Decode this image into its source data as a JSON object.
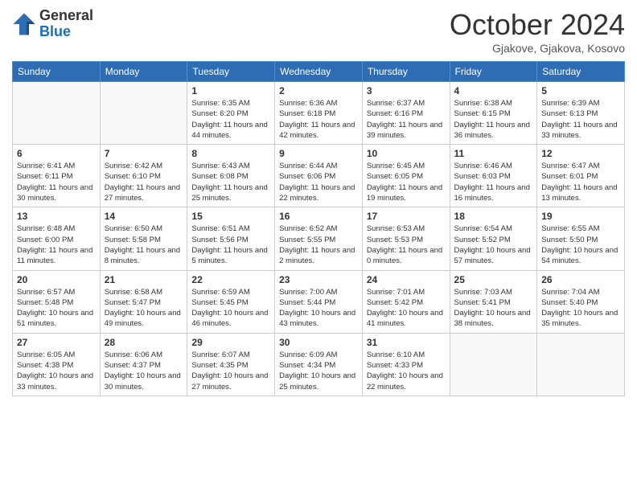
{
  "header": {
    "logo_line1": "General",
    "logo_line2": "Blue",
    "month_title": "October 2024",
    "location": "Gjakove, Gjakova, Kosovo"
  },
  "days_of_week": [
    "Sunday",
    "Monday",
    "Tuesday",
    "Wednesday",
    "Thursday",
    "Friday",
    "Saturday"
  ],
  "weeks": [
    [
      {
        "day": "",
        "info": ""
      },
      {
        "day": "",
        "info": ""
      },
      {
        "day": "1",
        "info": "Sunrise: 6:35 AM\nSunset: 6:20 PM\nDaylight: 11 hours and 44 minutes."
      },
      {
        "day": "2",
        "info": "Sunrise: 6:36 AM\nSunset: 6:18 PM\nDaylight: 11 hours and 42 minutes."
      },
      {
        "day": "3",
        "info": "Sunrise: 6:37 AM\nSunset: 6:16 PM\nDaylight: 11 hours and 39 minutes."
      },
      {
        "day": "4",
        "info": "Sunrise: 6:38 AM\nSunset: 6:15 PM\nDaylight: 11 hours and 36 minutes."
      },
      {
        "day": "5",
        "info": "Sunrise: 6:39 AM\nSunset: 6:13 PM\nDaylight: 11 hours and 33 minutes."
      }
    ],
    [
      {
        "day": "6",
        "info": "Sunrise: 6:41 AM\nSunset: 6:11 PM\nDaylight: 11 hours and 30 minutes."
      },
      {
        "day": "7",
        "info": "Sunrise: 6:42 AM\nSunset: 6:10 PM\nDaylight: 11 hours and 27 minutes."
      },
      {
        "day": "8",
        "info": "Sunrise: 6:43 AM\nSunset: 6:08 PM\nDaylight: 11 hours and 25 minutes."
      },
      {
        "day": "9",
        "info": "Sunrise: 6:44 AM\nSunset: 6:06 PM\nDaylight: 11 hours and 22 minutes."
      },
      {
        "day": "10",
        "info": "Sunrise: 6:45 AM\nSunset: 6:05 PM\nDaylight: 11 hours and 19 minutes."
      },
      {
        "day": "11",
        "info": "Sunrise: 6:46 AM\nSunset: 6:03 PM\nDaylight: 11 hours and 16 minutes."
      },
      {
        "day": "12",
        "info": "Sunrise: 6:47 AM\nSunset: 6:01 PM\nDaylight: 11 hours and 13 minutes."
      }
    ],
    [
      {
        "day": "13",
        "info": "Sunrise: 6:48 AM\nSunset: 6:00 PM\nDaylight: 11 hours and 11 minutes."
      },
      {
        "day": "14",
        "info": "Sunrise: 6:50 AM\nSunset: 5:58 PM\nDaylight: 11 hours and 8 minutes."
      },
      {
        "day": "15",
        "info": "Sunrise: 6:51 AM\nSunset: 5:56 PM\nDaylight: 11 hours and 5 minutes."
      },
      {
        "day": "16",
        "info": "Sunrise: 6:52 AM\nSunset: 5:55 PM\nDaylight: 11 hours and 2 minutes."
      },
      {
        "day": "17",
        "info": "Sunrise: 6:53 AM\nSunset: 5:53 PM\nDaylight: 11 hours and 0 minutes."
      },
      {
        "day": "18",
        "info": "Sunrise: 6:54 AM\nSunset: 5:52 PM\nDaylight: 10 hours and 57 minutes."
      },
      {
        "day": "19",
        "info": "Sunrise: 6:55 AM\nSunset: 5:50 PM\nDaylight: 10 hours and 54 minutes."
      }
    ],
    [
      {
        "day": "20",
        "info": "Sunrise: 6:57 AM\nSunset: 5:48 PM\nDaylight: 10 hours and 51 minutes."
      },
      {
        "day": "21",
        "info": "Sunrise: 6:58 AM\nSunset: 5:47 PM\nDaylight: 10 hours and 49 minutes."
      },
      {
        "day": "22",
        "info": "Sunrise: 6:59 AM\nSunset: 5:45 PM\nDaylight: 10 hours and 46 minutes."
      },
      {
        "day": "23",
        "info": "Sunrise: 7:00 AM\nSunset: 5:44 PM\nDaylight: 10 hours and 43 minutes."
      },
      {
        "day": "24",
        "info": "Sunrise: 7:01 AM\nSunset: 5:42 PM\nDaylight: 10 hours and 41 minutes."
      },
      {
        "day": "25",
        "info": "Sunrise: 7:03 AM\nSunset: 5:41 PM\nDaylight: 10 hours and 38 minutes."
      },
      {
        "day": "26",
        "info": "Sunrise: 7:04 AM\nSunset: 5:40 PM\nDaylight: 10 hours and 35 minutes."
      }
    ],
    [
      {
        "day": "27",
        "info": "Sunrise: 6:05 AM\nSunset: 4:38 PM\nDaylight: 10 hours and 33 minutes."
      },
      {
        "day": "28",
        "info": "Sunrise: 6:06 AM\nSunset: 4:37 PM\nDaylight: 10 hours and 30 minutes."
      },
      {
        "day": "29",
        "info": "Sunrise: 6:07 AM\nSunset: 4:35 PM\nDaylight: 10 hours and 27 minutes."
      },
      {
        "day": "30",
        "info": "Sunrise: 6:09 AM\nSunset: 4:34 PM\nDaylight: 10 hours and 25 minutes."
      },
      {
        "day": "31",
        "info": "Sunrise: 6:10 AM\nSunset: 4:33 PM\nDaylight: 10 hours and 22 minutes."
      },
      {
        "day": "",
        "info": ""
      },
      {
        "day": "",
        "info": ""
      }
    ]
  ]
}
